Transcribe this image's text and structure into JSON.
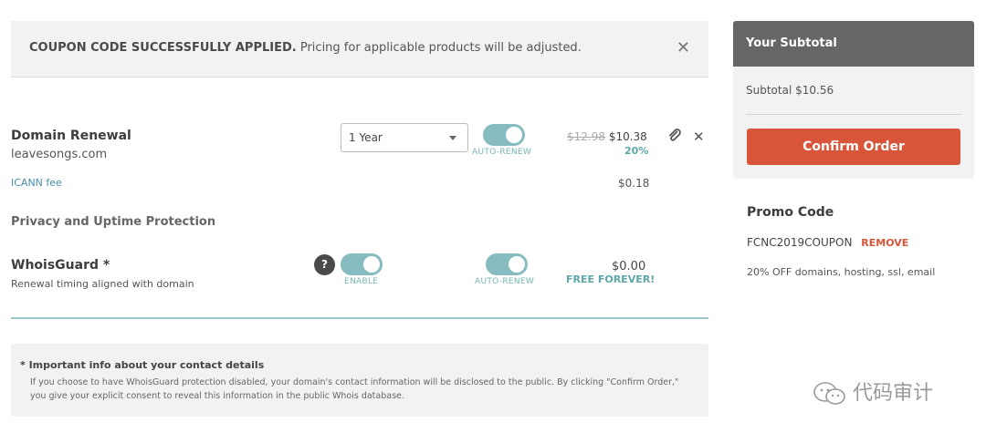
{
  "banner": {
    "bold": "COUPON CODE SUCCESSFULLY APPLIED.",
    "text": " Pricing for applicable products will be adjusted.",
    "close": "✕"
  },
  "domain_item": {
    "title": "Domain Renewal",
    "domain": "leavesongs.com",
    "term": "1 Year",
    "auto_renew_label": "AUTO-RENEW",
    "old_price": "$12.98",
    "new_price": "$10.38",
    "discount": "20%",
    "icann_label": "ICANN fee",
    "icann_price": "$0.18"
  },
  "privacy": {
    "section_title": "Privacy and Uptime Protection",
    "title": "WhoisGuard *",
    "subtitle": "Renewal timing aligned with domain",
    "help": "?",
    "enable_label": "ENABLE",
    "auto_renew_label": "AUTO-RENEW",
    "price": "$0.00",
    "free_label": "FREE FOREVER!"
  },
  "info": {
    "title": "* Important info about your contact details",
    "body": "If you choose to have WhoisGuard protection disabled, your domain's contact information will be disclosed to the public. By clicking \"Confirm Order,\" you give your explicit consent to reveal this information in the public Whois database."
  },
  "sidebar": {
    "title": "Your Subtotal",
    "subtotal": "Subtotal $10.56",
    "confirm_label": "Confirm Order"
  },
  "promo": {
    "title": "Promo Code",
    "code": "FCNC2019COUPON",
    "remove_label": "REMOVE",
    "description": "20% OFF domains, hosting, ssl, email"
  },
  "watermark": {
    "text": "代码审计"
  },
  "colors": {
    "accent_teal": "#86bcbf",
    "confirm_red": "#d8553a",
    "header_gray": "#666666"
  }
}
